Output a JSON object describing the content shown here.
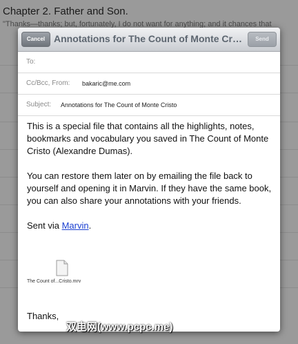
{
  "book": {
    "chapter_title": "Chapter 2. Father and Son.",
    "first_line": "\"Thanks—thanks; but, fortunately, I do not want for anything; and it chances that"
  },
  "compose": {
    "cancel_label": "Cancel",
    "title": "Annotations for The Count of Monte Cristo",
    "send_label": "Send",
    "to_label": "To:",
    "to_value": "",
    "cc_label": "Cc/Bcc, From:",
    "from_value": "bakaric@me.com",
    "subject_label": "Subject:",
    "subject_value": "Annotations for The Count of Monte Cristo",
    "body_paragraph_1": "This is a special file that contains all the highlights, notes, bookmarks and vocabulary you saved in The Count of Monte Cristo (Alexandre Dumas).",
    "body_paragraph_2": "You can restore them later on by emailing the file back to yourself and opening it in Marvin. If they have the same book, you can also share your annotations with your friends.",
    "sent_via_prefix": "Sent via ",
    "sent_via_link": "Marvin",
    "sent_via_suffix": ".",
    "attachment_icon": "document-icon",
    "attachment_name": "The Count of...Cristo.mrv",
    "closing": "Thanks,"
  },
  "watermark": "双电网(www.pcpc.me)"
}
